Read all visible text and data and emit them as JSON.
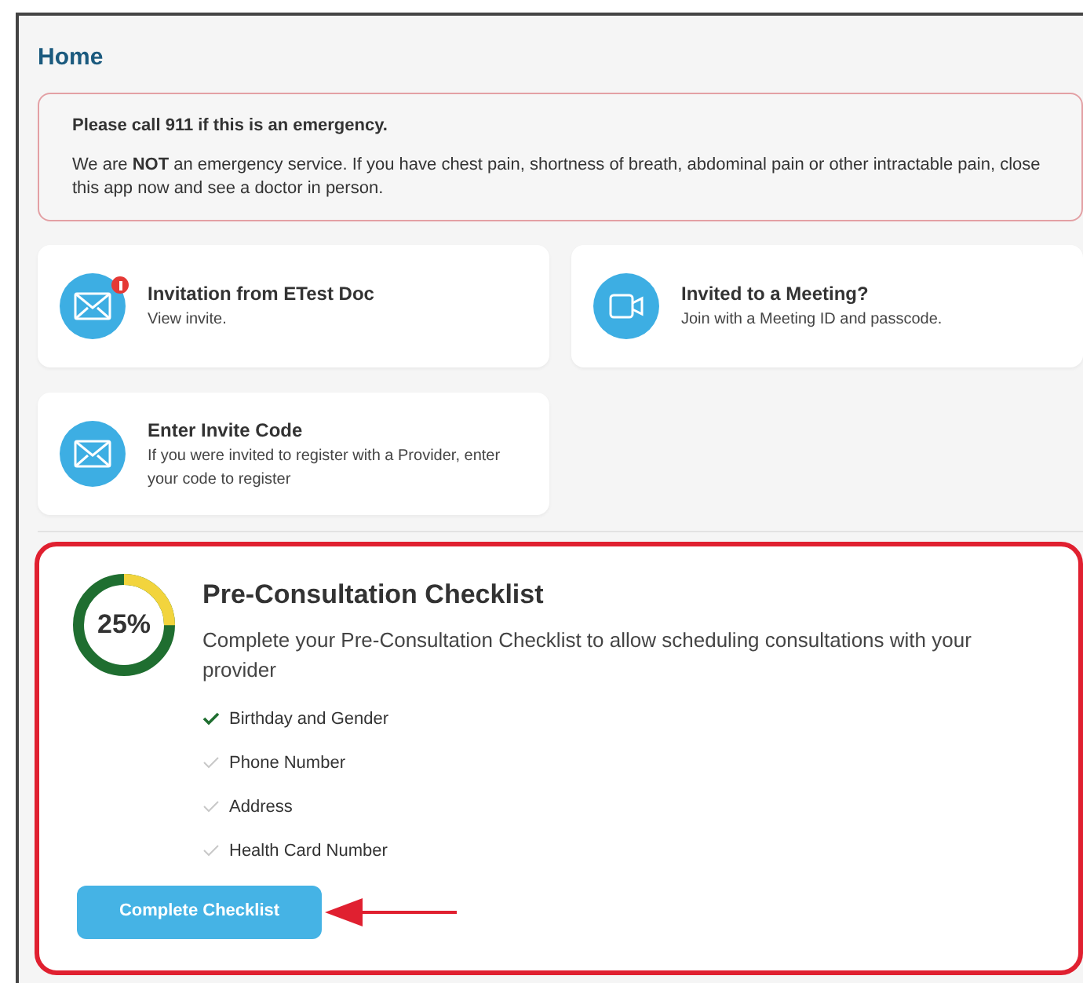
{
  "page_title": "Home",
  "alert": {
    "heading": "Please call 911 if this is an emergency.",
    "message": "We are **NOT** an emergency service. If you have chest pain, shortness of breath, abdominal pain or other intractable pain, close this app now and see a doctor in person."
  },
  "cards": [
    {
      "kind": "mail",
      "title": "Invitation from ETest Doc",
      "subtitle": "View invite.",
      "alert": true
    },
    {
      "kind": "video",
      "title": "Invited to a Meeting?",
      "subtitle": "Join with a Meeting ID and passcode.",
      "alert": false
    },
    {
      "kind": "mail",
      "title": "Enter Invite Code",
      "subtitle": "If you were invited to register with a Provider, enter your code to register",
      "alert": false
    }
  ],
  "checklist": {
    "progress": {
      "level": 0.25,
      "label": "25%"
    },
    "title": "Pre-Consultation Checklist",
    "description": "Complete your Pre-Consultation Checklist to allow scheduling consultations with your provider",
    "items": [
      {
        "label": "Birthday and Gender",
        "checked": true
      },
      {
        "label": "Phone Number",
        "checked": false
      },
      {
        "label": "Address",
        "checked": false
      },
      {
        "label": "Health Card Number",
        "checked": false
      }
    ],
    "button": "Complete Checklist"
  }
}
